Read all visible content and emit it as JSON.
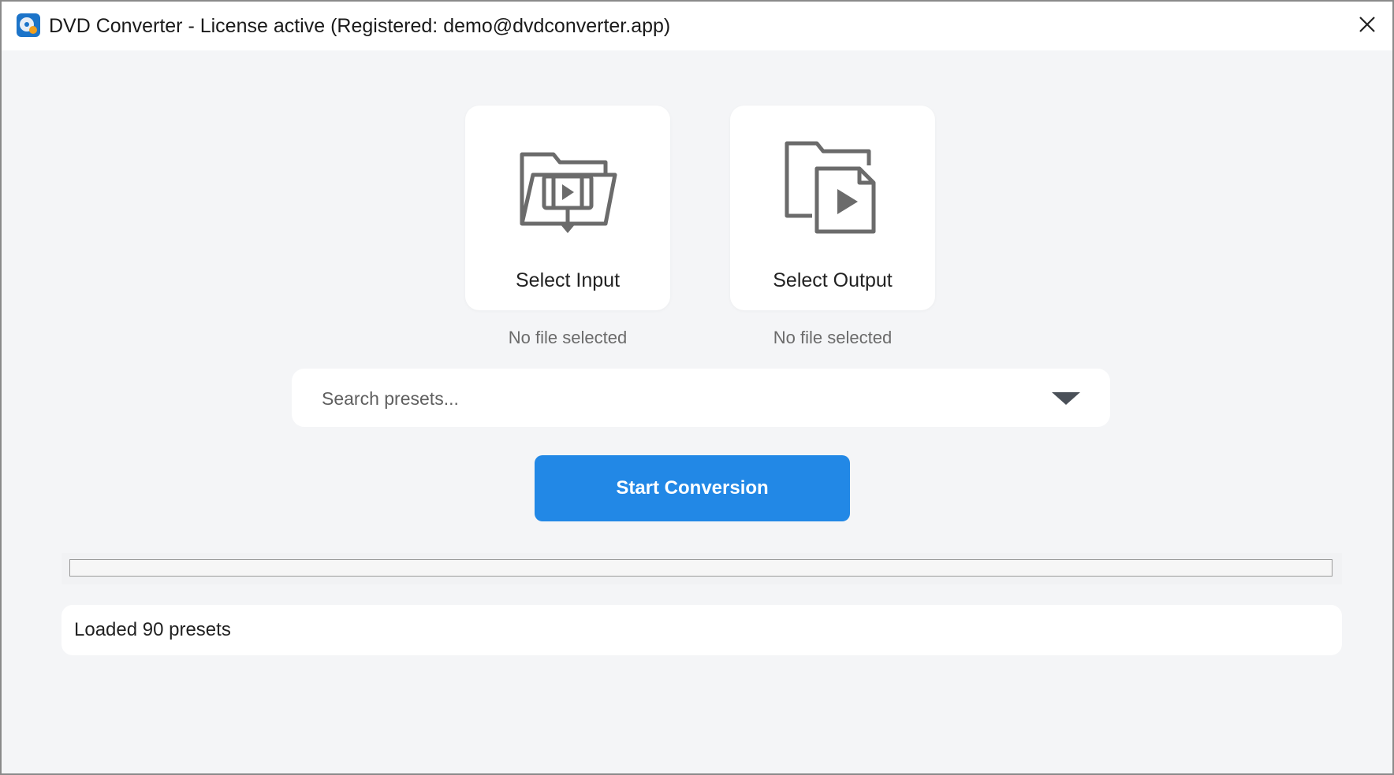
{
  "window": {
    "title": "DVD Converter - License active (Registered: demo@dvdconverter.app)",
    "app_icon": "dvd-disc-icon",
    "close_icon": "close-icon"
  },
  "input_card": {
    "label": "Select Input",
    "icon": "folder-video-import-icon",
    "status": "No file selected"
  },
  "output_card": {
    "label": "Select Output",
    "icon": "folder-video-export-icon",
    "status": "No file selected"
  },
  "presets": {
    "placeholder": "Search presets...",
    "value": "",
    "dropdown_icon": "chevron-down-icon"
  },
  "start_button": {
    "label": "Start Conversion"
  },
  "progress": {
    "value": 0
  },
  "status": {
    "text": "Loaded 90 presets"
  },
  "colors": {
    "accent": "#2288e6",
    "background": "#f4f5f7",
    "card": "#ffffff",
    "icon": "#6b6b6b"
  }
}
